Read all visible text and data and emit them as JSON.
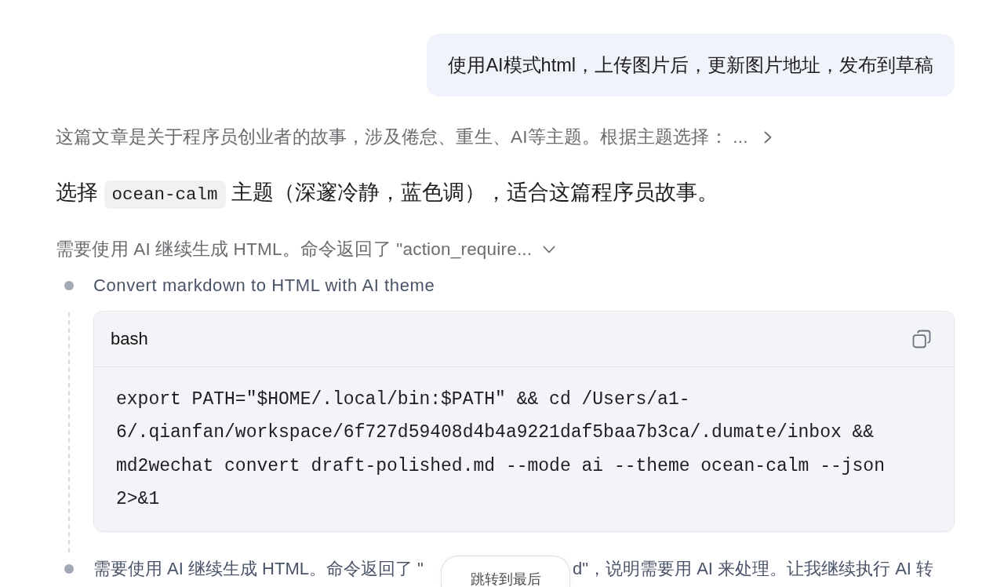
{
  "user_message": {
    "text": "使用AI模式html，上传图片后，更新图片地址，发布到草稿"
  },
  "reasoning": {
    "summary": "这篇文章是关于程序员创业者的故事，涉及倦怠、重生、AI等主题。根据主题选择： ...",
    "expanded": false
  },
  "reply": {
    "parts": [
      {
        "kind": "text",
        "text": "选择 "
      },
      {
        "kind": "code",
        "text": "ocean-calm"
      },
      {
        "kind": "text",
        "text": " 主题（深邃冷静，蓝色调），适合这篇程序员故事。"
      }
    ]
  },
  "action_group": {
    "summary": "需要使用 AI 继续生成 HTML。命令返回了 \"action_require...",
    "expanded": true,
    "steps": [
      {
        "kind": "command",
        "title": "Convert markdown to HTML with AI theme",
        "code_block": {
          "language": "bash",
          "lines": [
            "export PATH=\"$HOME/.local/bin:$PATH\" && cd /Users/a1-",
            "6/.qianfan/workspace/6f727d59408d4b4a9221daf5baa7b3ca/.dumate/inbox &&",
            "md2wechat convert draft-polished.md --mode ai --theme ocean-calm --json",
            "2>&1"
          ]
        }
      },
      {
        "kind": "note",
        "text_parts": [
          "需要使用 AI 继续生成 HTML。命令返回了 \"",
          "d\"，说明需要用 AI 来处理。让我继续执行 AI 转"
        ]
      }
    ]
  },
  "jump_button": {
    "label": "跳转到最后"
  }
}
